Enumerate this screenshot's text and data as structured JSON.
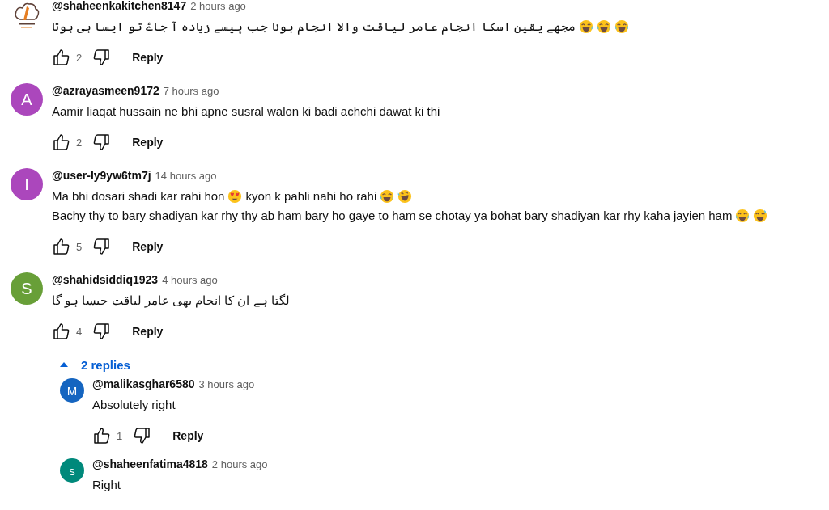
{
  "comments": [
    {
      "author": "@shaheenkakitchen8147",
      "time": "2 hours ago",
      "avatar": {
        "kind": "logo"
      },
      "lines": [
        [
          {
            "kind": "rtl_text",
            "text": "مجھے یقین اسکا انجام عامر لیاقت والا انجام ہونا جب پیسے زیادہ آ جاۓ تو ایسا ہی ہوتا"
          },
          {
            "kind": "laugh"
          },
          {
            "kind": "laugh"
          },
          {
            "kind": "laugh"
          }
        ]
      ],
      "likes": "2",
      "reply": "Reply"
    },
    {
      "author": "@azrayasmeen9172",
      "time": "7 hours ago",
      "avatar": {
        "kind": "letter",
        "letter": "A",
        "color": "#ab47bc"
      },
      "lines": [
        [
          {
            "kind": "text",
            "text": "Aamir liaqat hussain ne bhi apne susral walon ki badi achchi dawat ki thi"
          }
        ]
      ],
      "likes": "2",
      "reply": "Reply"
    },
    {
      "author": "@user-ly9yw6tm7j",
      "time": "14 hours ago",
      "avatar": {
        "kind": "letter",
        "letter": "I",
        "color": "#ab47bc"
      },
      "lines": [
        [
          {
            "kind": "text",
            "text": "Ma bhi dosari shadi kar rahi hon"
          },
          {
            "kind": "hearteyes"
          },
          {
            "kind": "text",
            "text": "kyon k pahli nahi ho rahi"
          },
          {
            "kind": "laugh"
          },
          {
            "kind": "rofl"
          }
        ],
        [
          {
            "kind": "text",
            "text": "Bachy thy to bary shadiyan kar rhy thy ab ham bary ho gaye to ham se chotay ya bohat bary shadiyan kar rhy kaha jayien ham"
          },
          {
            "kind": "laugh"
          },
          {
            "kind": "sweat"
          }
        ]
      ],
      "likes": "5",
      "reply": "Reply"
    },
    {
      "author": "@shahidsiddiq1923",
      "time": "4 hours ago",
      "avatar": {
        "kind": "letter",
        "letter": "S",
        "color": "#689f38"
      },
      "lines": [
        [
          {
            "kind": "rtl_text",
            "text": "لگتا ہے ان کا انجام بھی عامر لیاقت جیسا ہو گا"
          }
        ]
      ],
      "likes": "4",
      "reply": "Reply",
      "replies_toggle": {
        "label": "2 replies",
        "expanded": true
      },
      "replies": [
        {
          "author": "@malikasghar6580",
          "time": "3 hours ago",
          "avatar": {
            "kind": "letter",
            "letter": "M",
            "color": "#1565c0"
          },
          "lines": [
            [
              {
                "kind": "text",
                "text": "Absolutely right"
              }
            ]
          ],
          "likes": "1",
          "reply": "Reply"
        },
        {
          "author": "@shaheenfatima4818",
          "time": "2 hours ago",
          "avatar": {
            "kind": "letter",
            "letter": "s",
            "color": "#00897b"
          },
          "lines": [
            [
              {
                "kind": "text",
                "text": "Right"
              }
            ]
          ]
        }
      ]
    }
  ]
}
